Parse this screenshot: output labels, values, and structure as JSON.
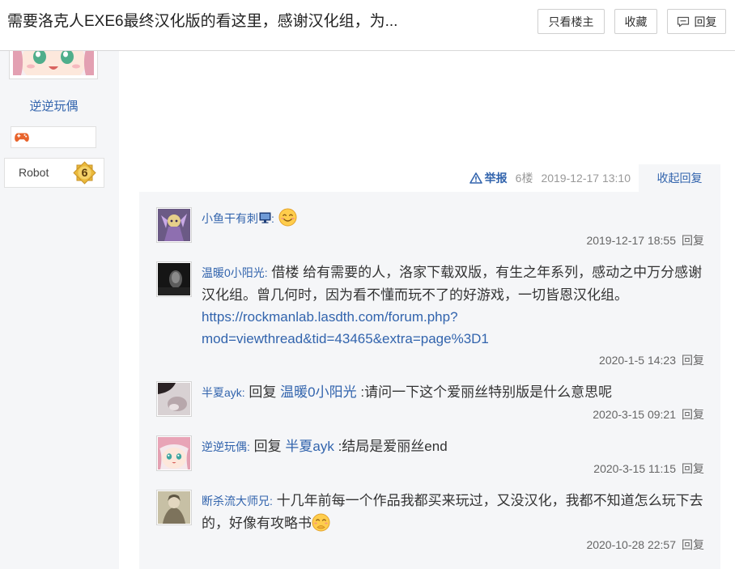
{
  "header": {
    "title": "需要洛克人EXE6最终汉化版的看这里，感谢汉化组，为...",
    "buttons": {
      "only_author": "只看楼主",
      "favorite": "收藏",
      "reply": "回复"
    },
    "reply_icon": "comment-icon"
  },
  "sidebar": {
    "username": "逆逆玩偶",
    "medal_icon": "gamepad-icon",
    "group": "Robot",
    "level": "6",
    "level_icon": "star-badge-icon"
  },
  "post_meta": {
    "report_icon": "warning-icon",
    "report": "举报",
    "floor": "6楼",
    "time": "2019-12-17 13:10",
    "collapse": "收起回复"
  },
  "colors": {
    "link": "#3264ad",
    "text": "#333333",
    "muted": "#999999",
    "panel": "#f5f6f8"
  },
  "comments": [
    {
      "author": "小鱼干有刺",
      "author_icon": "monitor-icon",
      "sep": ":",
      "emoji": "smile-emoji",
      "time": "2019-12-17 18:55",
      "reply": "回复"
    },
    {
      "author": "温暖0小阳光",
      "sep": ":",
      "text": "借楼 给有需要的人，洛家下载双版，有生之年系列，感动之中万分感谢汉化组。曾几何时，因为看不懂而玩不了的好游戏，一切皆恩汉化组。",
      "link": "https://rockmanlab.lasdth.com/forum.php?mod=viewthread&tid=43465&extra=page%3D1",
      "time": "2020-1-5 14:23",
      "reply": "回复"
    },
    {
      "author": "半夏ayk",
      "sep": ":",
      "reply_prefix": "回复",
      "reply_to": "温暖0小阳光",
      "text": ":请问一下这个爱丽丝特别版是什么意思呢",
      "time": "2020-3-15 09:21",
      "reply": "回复"
    },
    {
      "author": "逆逆玩偶",
      "sep": ":",
      "reply_prefix": "回复",
      "reply_to": "半夏ayk",
      "text": ":结局是爱丽丝end",
      "time": "2020-3-15 11:15",
      "reply": "回复"
    },
    {
      "author": "断杀流大师兄",
      "sep": ":",
      "text": "十几年前每一个作品我都买来玩过，又没汉化，我都不知道怎么玩下去的，好像有攻略书",
      "emoji": "shy-emoji",
      "time": "2020-10-28 22:57",
      "reply": "回复"
    }
  ]
}
